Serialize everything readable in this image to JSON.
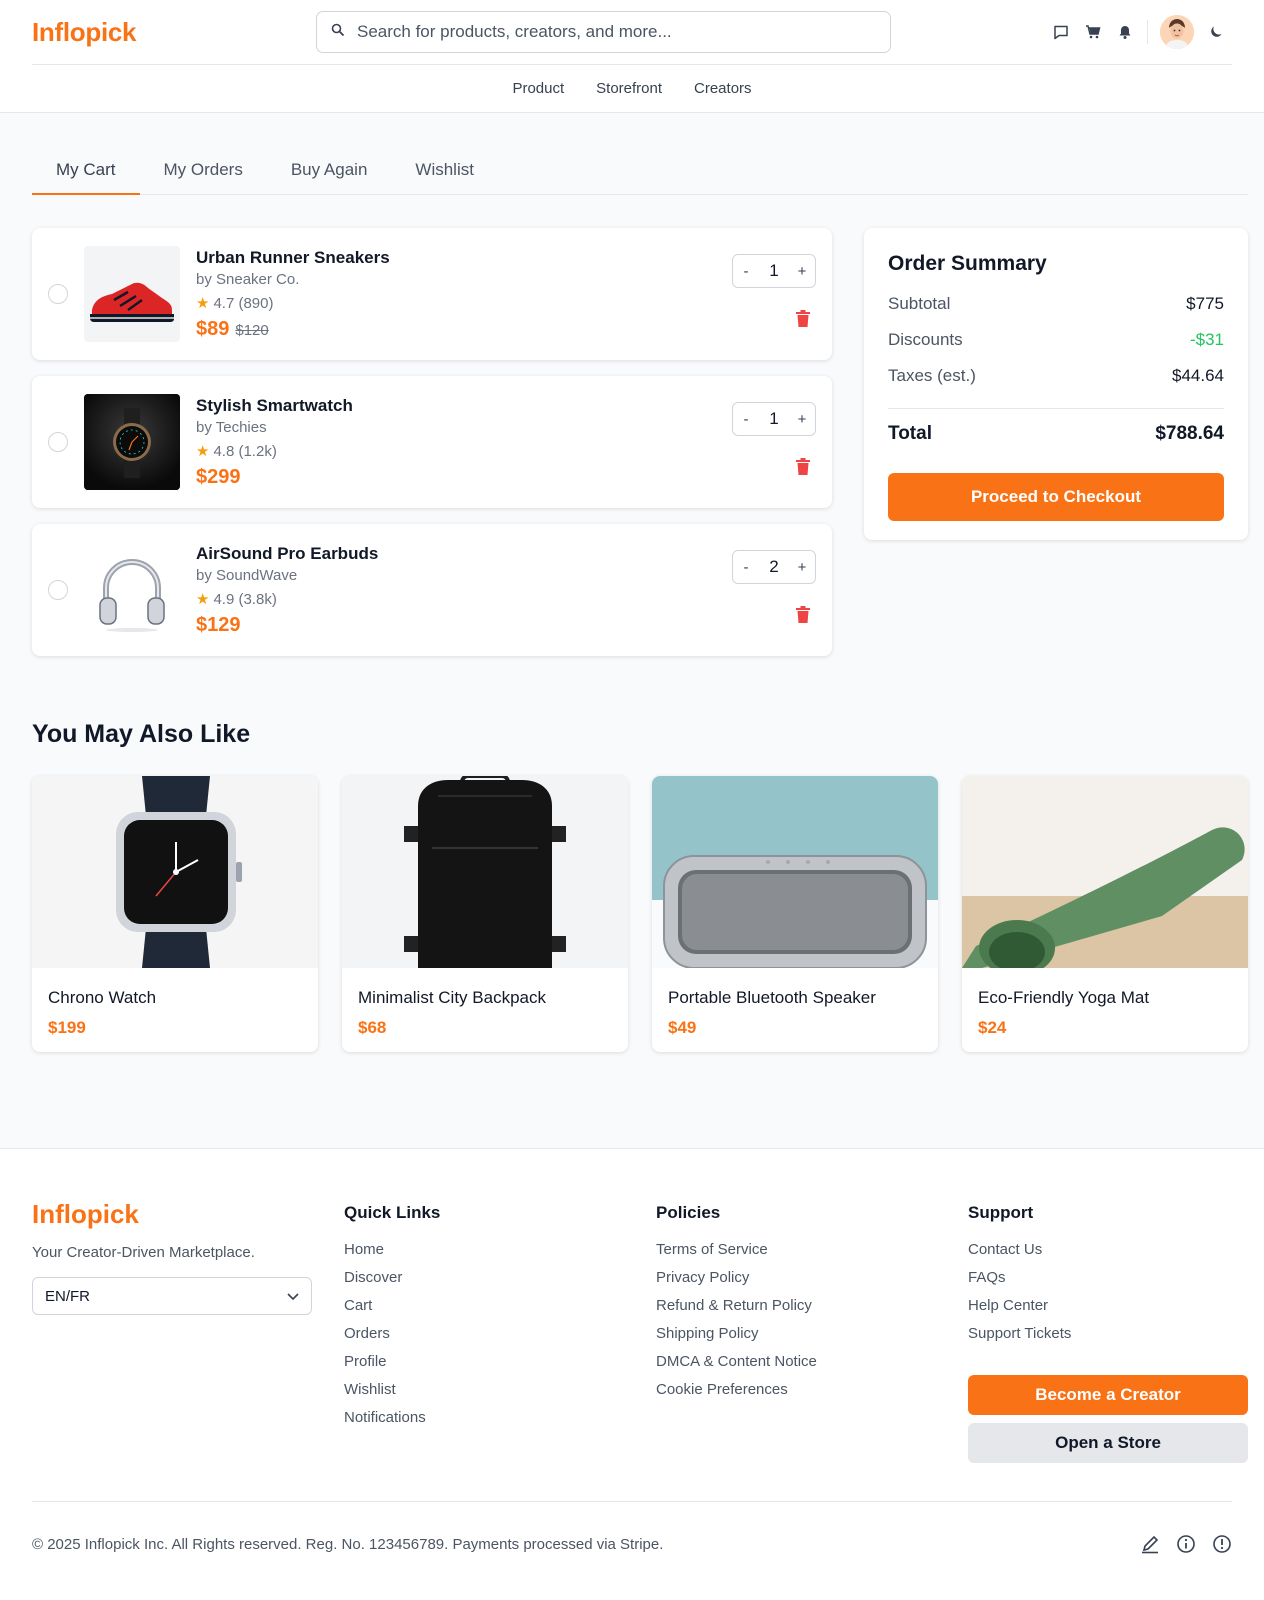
{
  "brand": {
    "name": "Inflopick",
    "accent": "#f97316"
  },
  "search": {
    "placeholder": "Search for products, creators, and more..."
  },
  "header_icons": [
    "chat-icon",
    "cart-icon",
    "bell-icon",
    "avatar",
    "moon-icon"
  ],
  "subnav": [
    "Product",
    "Storefront",
    "Creators"
  ],
  "tabs": [
    "My Cart",
    "My Orders",
    "Buy Again",
    "Wishlist"
  ],
  "active_tab": "My Cart",
  "cart": {
    "items": [
      {
        "name": "Urban Runner Sneakers",
        "by": "by Sneaker Co.",
        "rating": "4.7 (890)",
        "price": "$89",
        "old_price": "$120",
        "qty": "1"
      },
      {
        "name": "Stylish Smartwatch",
        "by": "by Techies",
        "rating": "4.8 (1.2k)",
        "price": "$299",
        "qty": "1"
      },
      {
        "name": "AirSound Pro Earbuds",
        "by": "by SoundWave",
        "rating": "4.9 (3.8k)",
        "price": "$129",
        "qty": "2"
      }
    ],
    "minus": "-",
    "plus": "+"
  },
  "summary": {
    "title": "Order Summary",
    "subtotal_label": "Subtotal",
    "subtotal": "$775",
    "discounts_label": "Discounts",
    "discounts": "-$31",
    "taxes_label": "Taxes (est.)",
    "taxes": "$44.64",
    "total_label": "Total",
    "total": "$788.64",
    "checkout": "Proceed to Checkout"
  },
  "recommend": {
    "title": "You May Also Like",
    "items": [
      {
        "name": "Chrono Watch",
        "price": "$199"
      },
      {
        "name": "Minimalist City Backpack",
        "price": "$68"
      },
      {
        "name": "Portable Bluetooth Speaker",
        "price": "$49"
      },
      {
        "name": "Eco-Friendly Yoga Mat",
        "price": "$24"
      }
    ]
  },
  "footer": {
    "tagline": "Your Creator-Driven Marketplace.",
    "language": "EN/FR",
    "quick_links_title": "Quick Links",
    "quick_links": [
      "Home",
      "Discover",
      "Cart",
      "Orders",
      "Profile",
      "Wishlist",
      "Notifications"
    ],
    "policies_title": "Policies",
    "policies": [
      "Terms of Service",
      "Privacy Policy",
      "Refund & Return Policy",
      "Shipping Policy",
      "DMCA & Content Notice",
      "Cookie Preferences"
    ],
    "support_title": "Support",
    "support": [
      "Contact Us",
      "FAQs",
      "Help Center",
      "Support Tickets"
    ],
    "become_creator": "Become a Creator",
    "open_store": "Open a Store",
    "copyright": "© 2025 Inflopick Inc. All Rights reserved. Reg. No. 123456789. Payments processed via Stripe.",
    "bottom_icons": [
      "edit-icon",
      "info-icon",
      "alert-icon"
    ]
  }
}
